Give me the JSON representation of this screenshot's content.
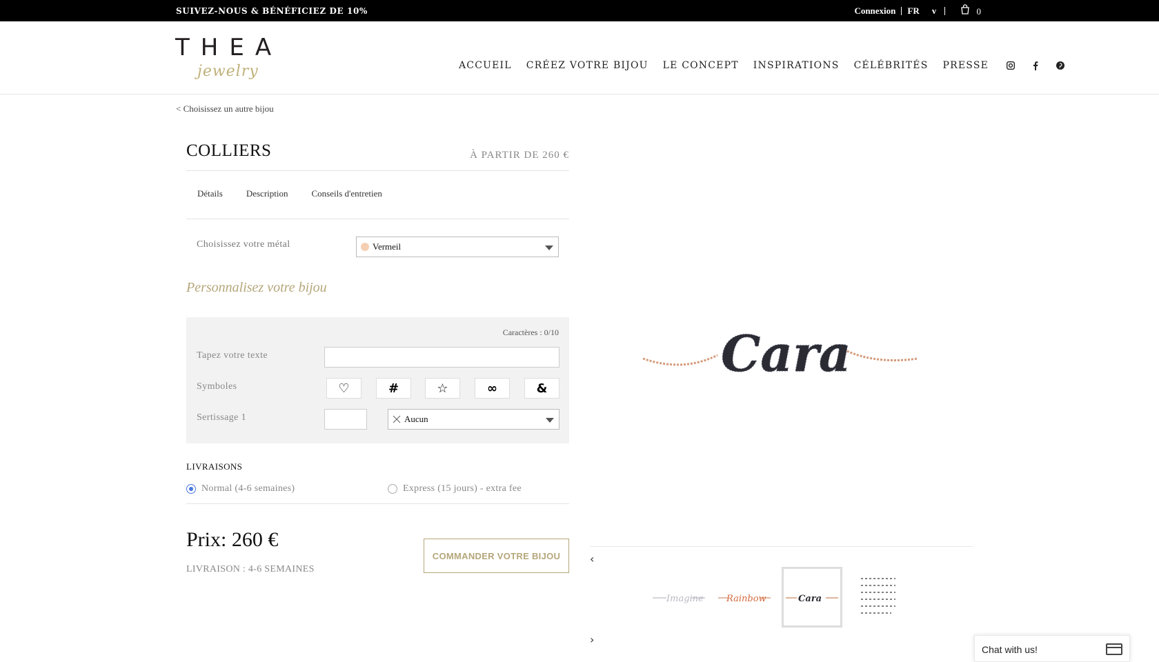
{
  "topbar": {
    "promo": "SUIVEZ-NOUS & BÉNÉFICIEZ DE 10%",
    "login": "Connexion",
    "lang": "FR",
    "lang_arrow": "v",
    "cart_count": "0"
  },
  "brand": {
    "name": "THEA",
    "sub": "jewelry"
  },
  "nav": {
    "items": [
      "ACCUEIL",
      "CRÉEZ VOTRE BIJOU",
      "LE CONCEPT",
      "INSPIRATIONS",
      "CÉLÉBRITÉS",
      "PRESSE"
    ],
    "social": [
      "instagram-icon",
      "facebook-icon",
      "pinterest-icon"
    ]
  },
  "back_link": "< Choisissez un autre bijou",
  "product": {
    "title": "COLLIERS",
    "price_from": "À PARTIR DE 260 €",
    "tabs": [
      "Détails",
      "Description",
      "Conseils d'entretien"
    ],
    "metal_label": "Choisissez votre métal",
    "metal_value": "Vermeil",
    "metal_color": "#f5cfb3"
  },
  "personalize": {
    "heading": "Personnalisez votre bijou",
    "chars": "Caractères : 0/10",
    "text_label": "Tapez votre texte",
    "text_value": "",
    "symbols_label": "Symboles",
    "symbols": [
      "♡",
      "#",
      "☆",
      "∞",
      "&"
    ],
    "setting_label": "Sertissage 1",
    "setting_value": "Aucun"
  },
  "delivery": {
    "heading": "LIVRAISONS",
    "options": [
      "Normal (4-6 semaines)",
      "Express (15 jours) - extra fee"
    ],
    "selected": 0
  },
  "order": {
    "price": "Prix: 260 €",
    "delivery_note": "LIVRAISON : 4-6 SEMAINES",
    "cta": "COMMANDER VOTRE BIJOU"
  },
  "gallery": {
    "hero_text": "Cara",
    "thumbs": [
      "Imagine",
      "Rainbow",
      "Cara",
      "font-chart"
    ],
    "selected": 2
  },
  "chat": {
    "label": "Chat with us!"
  },
  "colors": {
    "accent": "#b5a67a",
    "radio": "#4a78e0",
    "topbar": "#000000"
  }
}
